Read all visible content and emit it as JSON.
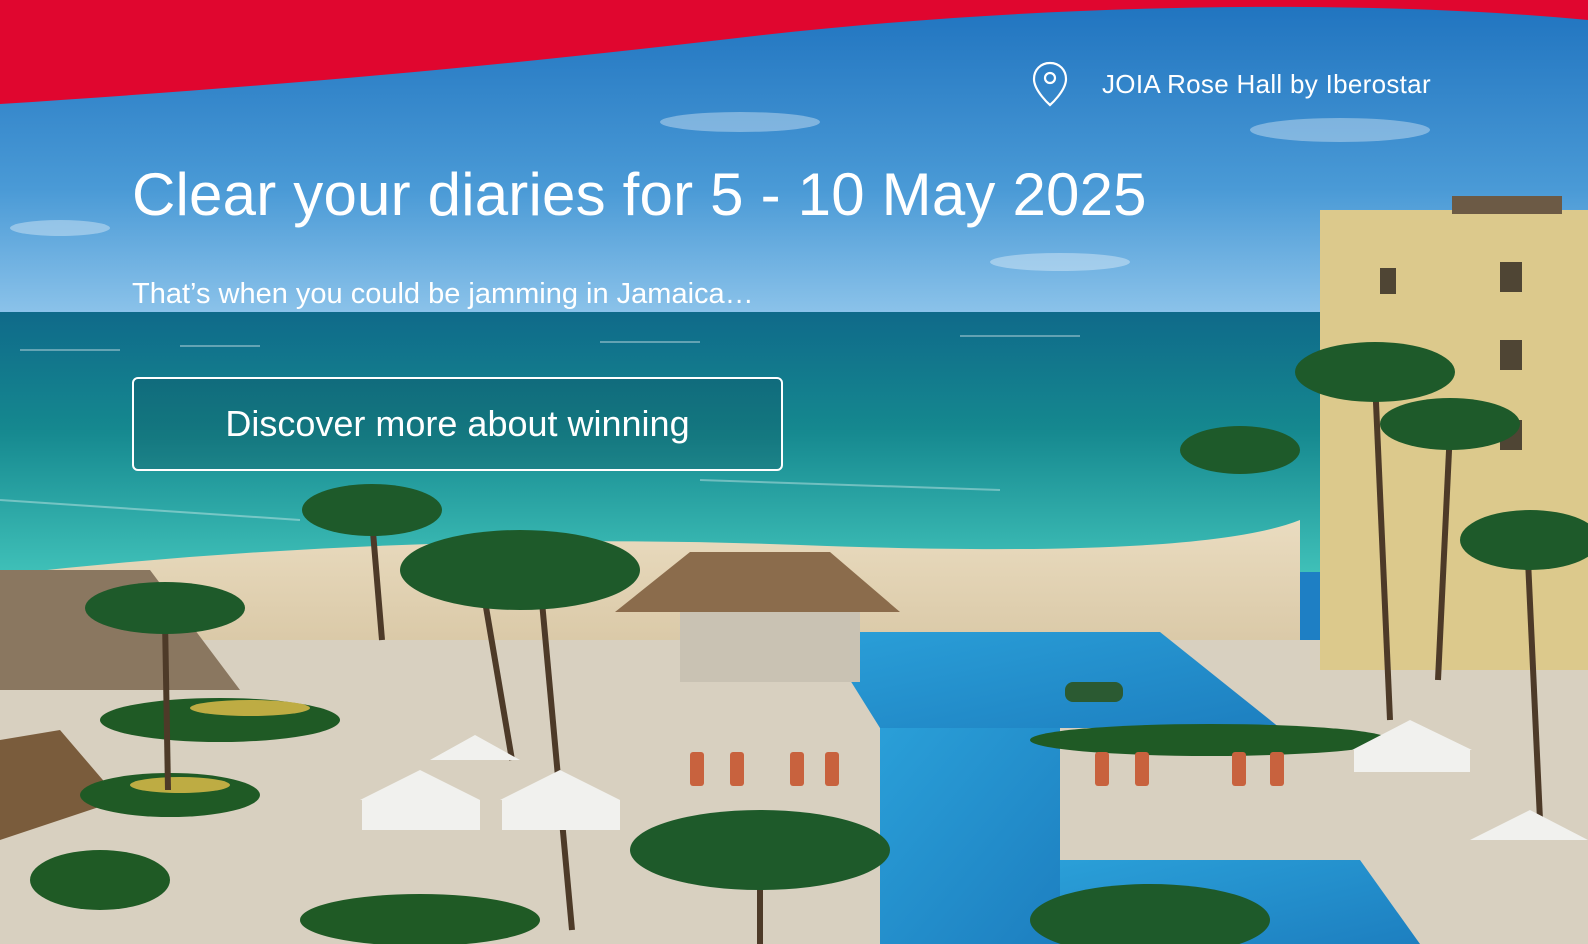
{
  "hero": {
    "location": "JOIA Rose Hall by Iberostar",
    "location_icon": "map-pin-icon",
    "headline": "Clear your diaries for 5 - 10 May 2025",
    "subline": "That’s when you could be jamming in Jamaica…",
    "cta_label": "Discover more about winning"
  },
  "colors": {
    "brand_red": "#e0062f",
    "text": "#ffffff",
    "sea": "#1a9aa6",
    "sky": "#2a86c8"
  }
}
